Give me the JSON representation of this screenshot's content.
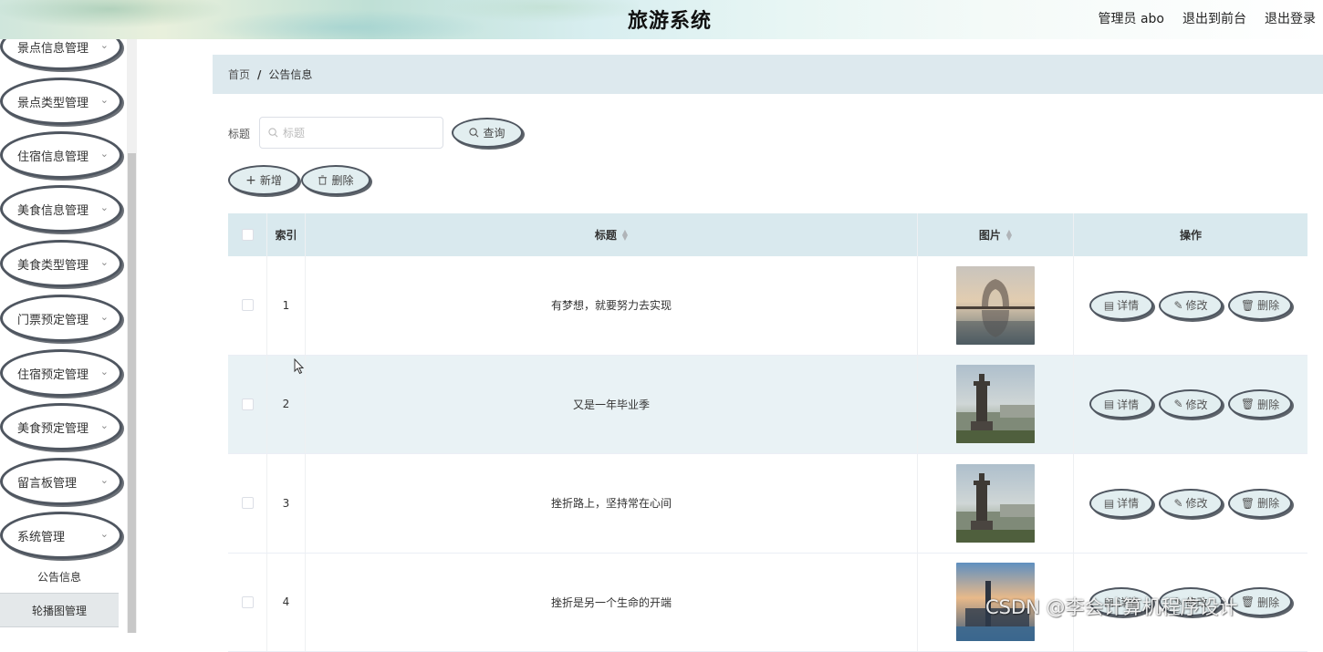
{
  "header": {
    "title": "旅游系统",
    "user_label": "管理员 abo",
    "back_to_front": "退出到前台",
    "logout": "退出登录"
  },
  "sidebar": {
    "items": [
      {
        "label": "景点信息管理"
      },
      {
        "label": "景点类型管理"
      },
      {
        "label": "住宿信息管理"
      },
      {
        "label": "美食信息管理"
      },
      {
        "label": "美食类型管理"
      },
      {
        "label": "门票预定管理"
      },
      {
        "label": "住宿预定管理"
      },
      {
        "label": "美食预定管理"
      },
      {
        "label": "留言板管理"
      },
      {
        "label": "系统管理"
      }
    ],
    "subitems": [
      {
        "label": "公告信息"
      },
      {
        "label": "轮播图管理"
      }
    ]
  },
  "breadcrumb": {
    "home": "首页",
    "separator": "/",
    "current": "公告信息"
  },
  "search": {
    "label": "标题",
    "placeholder": "标题",
    "query_button": "查询"
  },
  "toolbar": {
    "add_label": "新增",
    "delete_label": "删除"
  },
  "table": {
    "columns": {
      "index": "索引",
      "title": "标题",
      "image": "图片",
      "ops": "操作"
    },
    "rows": [
      {
        "index": "1",
        "title": "有梦想，就要努力去实现",
        "image": "arch-reflection"
      },
      {
        "index": "2",
        "title": "又是一年毕业季",
        "image": "monument-city"
      },
      {
        "index": "3",
        "title": "挫折路上，坚持常在心间",
        "image": "monument-city"
      },
      {
        "index": "4",
        "title": "挫折是另一个生命的开端",
        "image": "sunset-tower"
      }
    ],
    "op_labels": {
      "detail": "详情",
      "edit": "修改",
      "delete": "删除"
    }
  },
  "watermark": "CSDN @李会计算机程序设计",
  "colors": {
    "header_bg": "#d8eef0",
    "breadcrumb_bg": "#dde9ee",
    "table_head_bg": "#d9e9ee",
    "row_alt_bg": "#e9f2f5",
    "button_bg": "#e2eef0",
    "button_border": "#4f5660"
  }
}
